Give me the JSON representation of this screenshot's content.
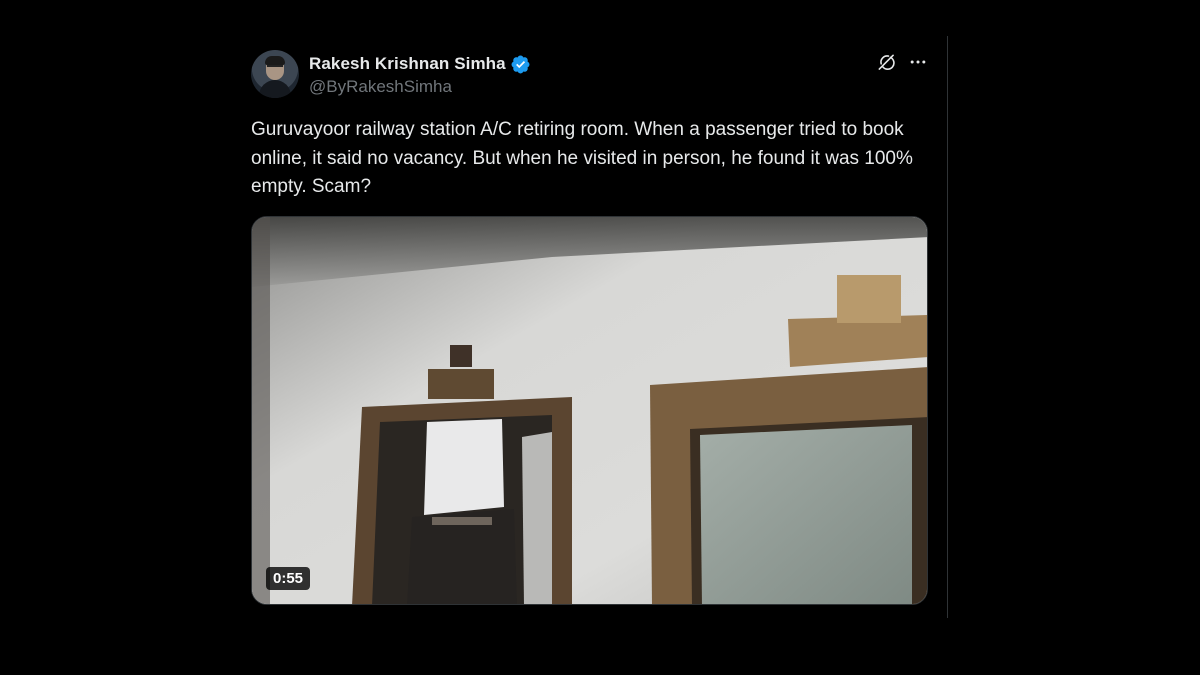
{
  "tweet": {
    "author": {
      "display_name": "Rakesh Krishnan Simha",
      "handle": "@ByRakeshSimha",
      "verified": true,
      "verified_color": "#1d9bf0"
    },
    "actions": {
      "grok_icon": "grok-icon",
      "more_icon": "more-icon"
    },
    "text": "Guruvayoor railway station A/C retiring room. When a passenger tried to book online, it said no vacancy. But when he visited in person, he found it was 100% empty. Scam?",
    "media": {
      "type": "video",
      "duration": "0:55"
    }
  },
  "colors": {
    "background": "#000000",
    "text_primary": "#e7e9ea",
    "text_secondary": "#71767b",
    "divider": "#2f3336"
  }
}
